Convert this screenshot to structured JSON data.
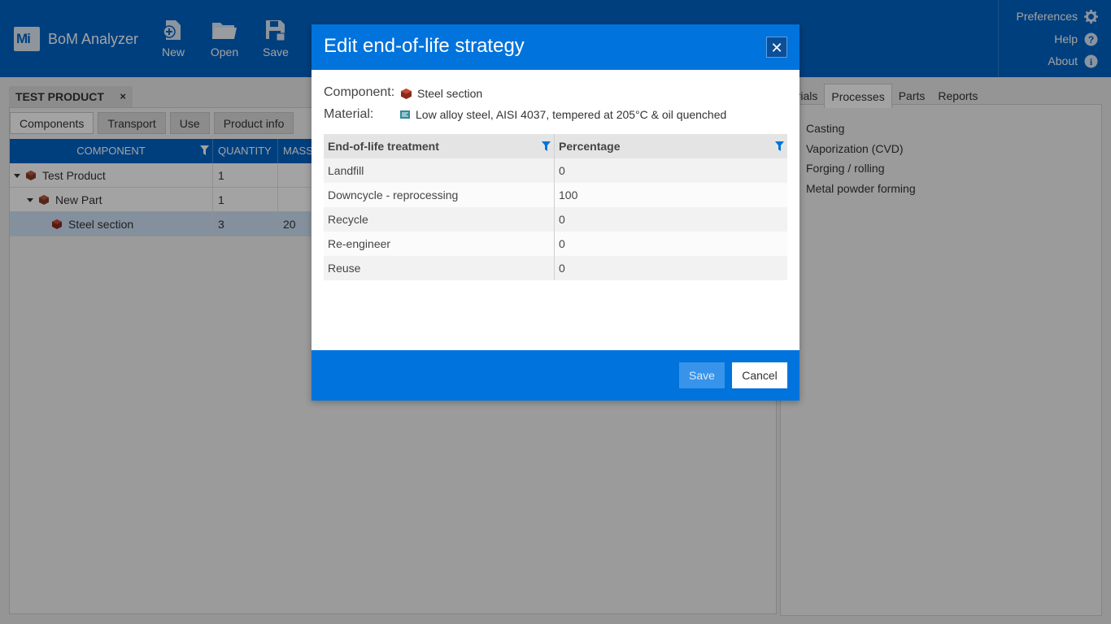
{
  "app": {
    "logo": "Mi",
    "title": "BoM Analyzer"
  },
  "toolbar": [
    {
      "label": "New",
      "icon": "new-icon"
    },
    {
      "label": "Open",
      "icon": "folder-icon"
    },
    {
      "label": "Save",
      "icon": "save-icon"
    }
  ],
  "menu": {
    "preferences": "Preferences",
    "help": "Help",
    "about": "About"
  },
  "document": {
    "tab_title": "TEST PRODUCT",
    "close": "×"
  },
  "subtabs": [
    "Components",
    "Transport",
    "Use",
    "Product info"
  ],
  "grid": {
    "columns": [
      "COMPONENT",
      "QUANTITY",
      "MASS"
    ],
    "rows": [
      {
        "name": "Test Product",
        "quantity": "1",
        "mass": ""
      },
      {
        "name": "New Part",
        "quantity": "1",
        "mass": ""
      },
      {
        "name": "Steel section",
        "quantity": "3",
        "mass": "20"
      }
    ]
  },
  "right_tabs": [
    "terials",
    "Processes",
    "Parts",
    "Reports"
  ],
  "processes": [
    "Casting",
    "Vaporization (CVD)",
    "Forging / rolling",
    "Metal powder forming"
  ],
  "dialog": {
    "title": "Edit end-of-life strategy",
    "close": "✕",
    "component_label": "Component:",
    "component_value": "Steel section",
    "material_label": "Material:",
    "material_value": "Low alloy steel, AISI 4037, tempered at 205°C & oil quenched",
    "table": {
      "headers": [
        "End-of-life treatment",
        "Percentage"
      ],
      "rows": [
        {
          "treatment": "Landfill",
          "percentage": "0"
        },
        {
          "treatment": "Downcycle - reprocessing",
          "percentage": "100"
        },
        {
          "treatment": "Recycle",
          "percentage": "0"
        },
        {
          "treatment": "Re-engineer",
          "percentage": "0"
        },
        {
          "treatment": "Reuse",
          "percentage": "0"
        }
      ]
    },
    "save_label": "Save",
    "cancel_label": "Cancel"
  },
  "colors": {
    "brand_blue": "#0063c6",
    "dialog_blue": "#0073dc",
    "selection": "#cfe2f6",
    "process_marker": "#1c8a2f"
  }
}
